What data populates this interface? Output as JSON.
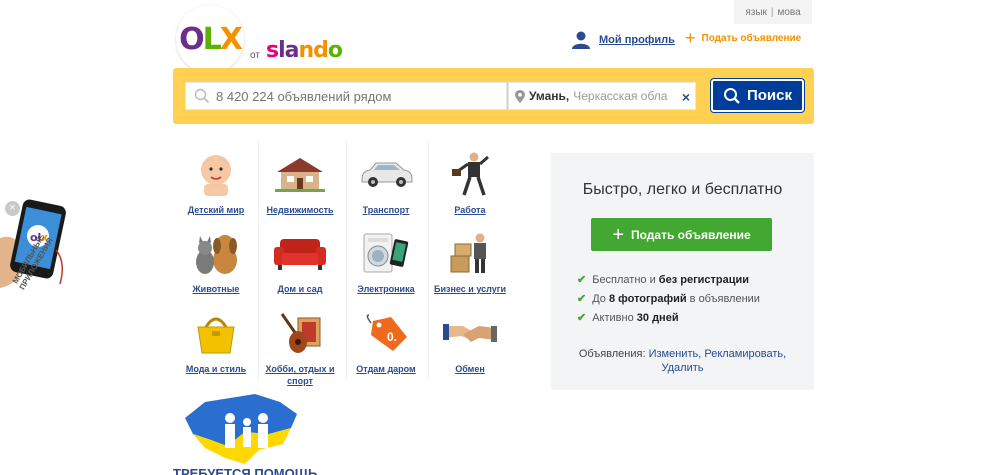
{
  "language_bar": {
    "lang_ru": "язык",
    "lang_ua": "мова"
  },
  "logo": {
    "brand_o": "O",
    "brand_l": "L",
    "brand_x": "X",
    "ot": "от",
    "partner": [
      "s",
      "la",
      "nd",
      "o"
    ]
  },
  "header": {
    "profile_label": "Мой профиль",
    "post_ad_label": "Подать объявление"
  },
  "search": {
    "placeholder": "8 420 224 объявлений рядом",
    "location_city": "Умань,",
    "location_region": "Черкасская обла",
    "clear_icon": "×",
    "button_label": "Поиск"
  },
  "categories": [
    {
      "label": "Детский мир",
      "icon": "baby-icon"
    },
    {
      "label": "Недвижимость",
      "icon": "house-icon"
    },
    {
      "label": "Транспорт",
      "icon": "car-icon"
    },
    {
      "label": "Работа",
      "icon": "businessman-icon"
    },
    {
      "label": "Животные",
      "icon": "pets-icon"
    },
    {
      "label": "Дом и сад",
      "icon": "sofa-icon"
    },
    {
      "label": "Электроника",
      "icon": "electronics-icon"
    },
    {
      "label": "Бизнес и услуги",
      "icon": "delivery-icon"
    },
    {
      "label": "Мода и стиль",
      "icon": "handbag-icon"
    },
    {
      "label": "Хобби, отдых и спорт",
      "icon": "guitar-icon"
    },
    {
      "label": "Отдам даром",
      "icon": "price-tag-icon"
    },
    {
      "label": "Обмен",
      "icon": "handshake-icon"
    }
  ],
  "promo": {
    "title": "Быстро, легко и бесплатно",
    "button_label": "Подать объявление",
    "features": [
      {
        "pre": "Бесплатно и ",
        "bold": "без регистрации",
        "post": ""
      },
      {
        "pre": "До ",
        "bold": "8 фотографий",
        "post": " в объявлении"
      },
      {
        "pre": "Активно ",
        "bold": "30 дней",
        "post": ""
      }
    ],
    "links_prefix": "Объявления:",
    "link_edit": "Изменить,",
    "link_promote": "Рекламировать,",
    "link_delete": "Удалить"
  },
  "mobile_apps": {
    "close": "×",
    "line1": "МОБИЛЬНЫЕ",
    "line2": "ПРИЛОЖЕНИЯ"
  },
  "banner": {
    "text": "ТРЕБУЕТСЯ ПОМОЩЬ"
  },
  "colors": {
    "accent_yellow": "#ffd152",
    "link_blue": "#2a4b8f",
    "search_blue": "#003c99",
    "post_green": "#43a832",
    "orange": "#f39200"
  }
}
